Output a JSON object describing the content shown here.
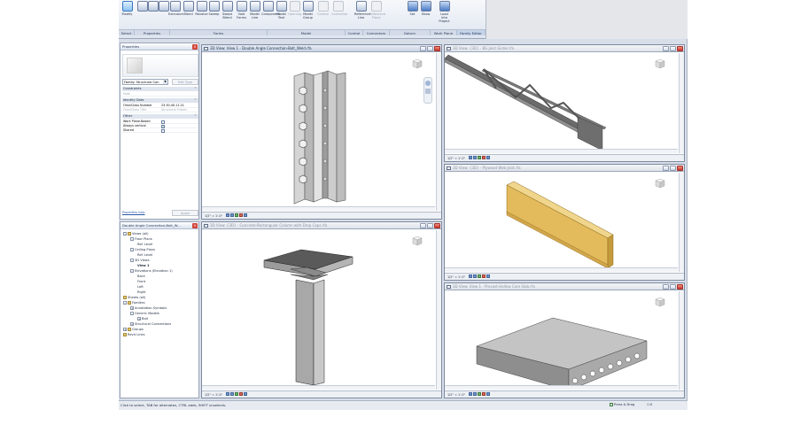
{
  "ribbon": {
    "tools": [
      {
        "label": "Modify",
        "icon": "cursor-arrow-icon",
        "active": true
      },
      {
        "label": "",
        "icon": "type-properties-icon"
      },
      {
        "label": "",
        "icon": "family-types-icon"
      },
      {
        "label": "",
        "icon": "family-category-icon"
      },
      {
        "label": "Extrusion",
        "icon": "extrusion-icon"
      },
      {
        "label": "Blend",
        "icon": "blend-icon"
      },
      {
        "label": "Revolve",
        "icon": "revolve-icon"
      },
      {
        "label": "Sweep",
        "icon": "sweep-icon"
      },
      {
        "label": "Swept Blend",
        "icon": "swept-blend-icon"
      },
      {
        "label": "Void Forms",
        "icon": "void-forms-icon"
      },
      {
        "label": "Model Line",
        "icon": "model-line-icon"
      },
      {
        "label": "Component",
        "icon": "component-icon"
      },
      {
        "label": "Model Text",
        "icon": "model-text-icon"
      },
      {
        "label": "Opening",
        "icon": "opening-icon",
        "disabled": true
      },
      {
        "label": "Model Group",
        "icon": "model-group-icon"
      },
      {
        "label": "Control",
        "icon": "control-icon",
        "disabled": true
      },
      {
        "label": "Connector",
        "icon": "connector-icon",
        "disabled": true
      },
      {
        "label": "Reference Line",
        "icon": "reference-line-icon"
      },
      {
        "label": "Reference Plane",
        "icon": "reference-plane-icon",
        "disabled": true
      },
      {
        "label": "Set",
        "icon": "set-workplane-icon"
      },
      {
        "label": "Show",
        "icon": "show-workplane-icon"
      },
      {
        "label": "Load into Project",
        "icon": "load-into-project-icon"
      }
    ],
    "panels": [
      "Select",
      "Properties",
      "Forms",
      "Model",
      "Control",
      "Connectors",
      "Datum",
      "Work Plane",
      "Family Editor"
    ]
  },
  "properties": {
    "title": "Properties",
    "type_filter": "Family: Structural Con",
    "edit_type": "Edit Type",
    "groups": [
      {
        "label": "Constraints",
        "rows": [
          {
            "key": "Host",
            "value": "",
            "grey": true
          }
        ]
      },
      {
        "label": "Identity Data",
        "rows": [
          {
            "key": "OmniClass Number",
            "value": "23.30.40.11.21"
          },
          {
            "key": "OmniClass Title",
            "value": "Structural Framin",
            "grey": true
          }
        ]
      },
      {
        "label": "Other",
        "rows": [
          {
            "key": "Work Plane-Based",
            "value": "",
            "check": false
          },
          {
            "key": "Always vertical",
            "value": "",
            "check": true
          },
          {
            "key": "Shared",
            "value": "",
            "check": false
          }
        ]
      }
    ],
    "help_link": "Properties help",
    "apply": "Apply"
  },
  "browser": {
    "title": "Double Angle Connection-Bolt_W...",
    "items": [
      {
        "label": "Views (all)",
        "level": 0,
        "toggle": "-",
        "icon": true
      },
      {
        "label": "Floor Plans",
        "level": 1,
        "toggle": "-"
      },
      {
        "label": "Ref. Level",
        "level": 2
      },
      {
        "label": "Ceiling Plans",
        "level": 1,
        "toggle": "-"
      },
      {
        "label": "Ref. Level",
        "level": 2
      },
      {
        "label": "3D Views",
        "level": 1,
        "toggle": "-"
      },
      {
        "label": "View 1",
        "level": 2,
        "bold": true
      },
      {
        "label": "Elevations (Elevation 1)",
        "level": 1,
        "toggle": "-"
      },
      {
        "label": "Back",
        "level": 2
      },
      {
        "label": "Front",
        "level": 2
      },
      {
        "label": "Left",
        "level": 2
      },
      {
        "label": "Right",
        "level": 2
      },
      {
        "label": "Sheets (all)",
        "level": 0,
        "icon": true
      },
      {
        "label": "Families",
        "level": 0,
        "toggle": "-",
        "icon": true
      },
      {
        "label": "Annotation Symbols",
        "level": 1,
        "toggle": "+"
      },
      {
        "label": "Generic Models",
        "level": 1,
        "toggle": "-"
      },
      {
        "label": "Bolt",
        "level": 2,
        "toggle": "+"
      },
      {
        "label": "Structural Connections",
        "level": 1,
        "toggle": "+"
      },
      {
        "label": "Groups",
        "level": 0,
        "toggle": "+",
        "icon": true
      },
      {
        "label": "Revit Links",
        "level": 0,
        "icon": true
      }
    ]
  },
  "views": {
    "v1": {
      "title": "3D View: View 1 - Double Angle Connection-Bolt_Weld.rfa",
      "scale": "1/2\" = 1'-0\"",
      "active": true
    },
    "v2": {
      "title": "3D View: {3D} - BG Joist Girder.rfa",
      "scale": "1/2\" = 1'-0\""
    },
    "v3": {
      "title": "3D View: {3D} - Plywood Web Joist.rfa",
      "scale": "1/2\" = 1'-0\""
    },
    "v4": {
      "title": "3D View: {3D} - Concrete-Rectangular Column with Drop Caps.rfa",
      "scale": "1/2\" = 1'-0\""
    },
    "v5": {
      "title": "3D View: View 1 - Precast-Hollow Core Slab.rfa",
      "scale": "1/2\" = 1'-0\""
    }
  },
  "status": {
    "message": "Click to select, TAB for alternates, CTRL adds, SHIFT unselects.",
    "press_drag": "Press & Drag",
    "filter_count": ":0"
  }
}
